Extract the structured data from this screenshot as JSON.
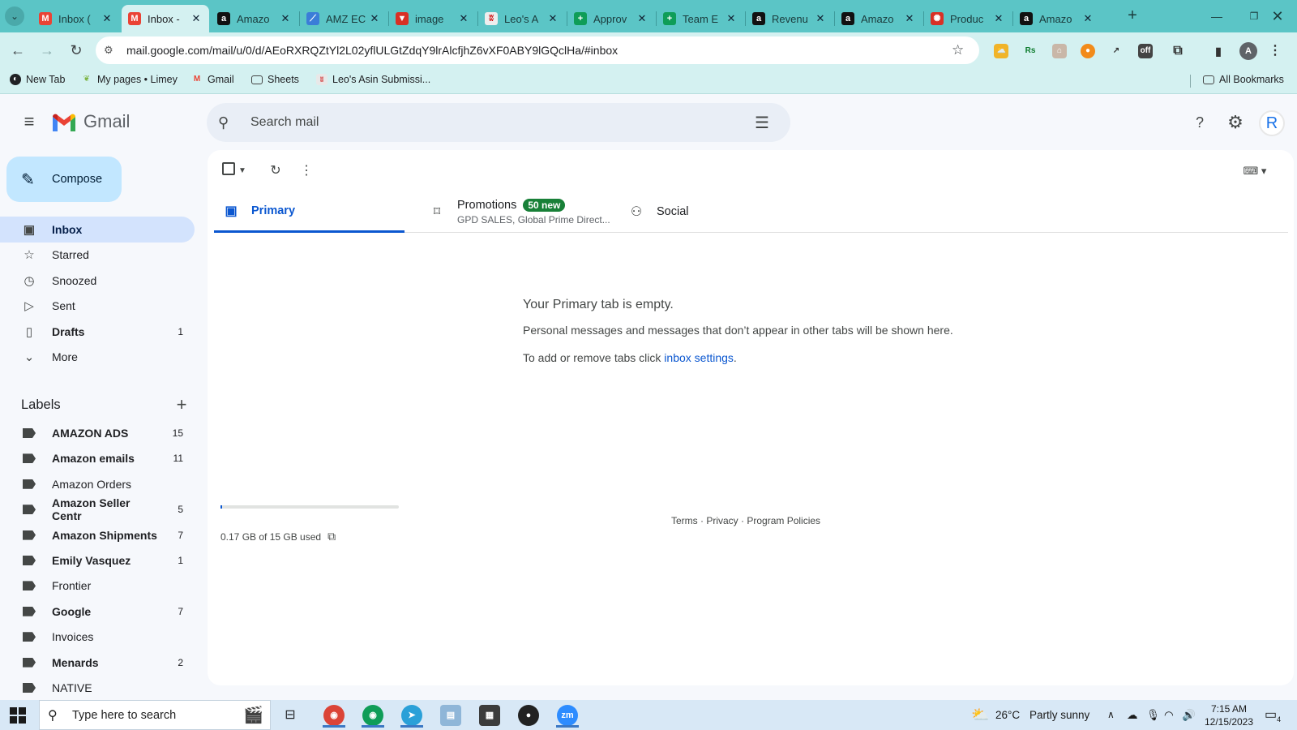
{
  "browser": {
    "tabs": [
      {
        "title": "Inbox (",
        "favicon": "gmail-favicon",
        "active": false
      },
      {
        "title": "Inbox -",
        "favicon": "gmail-favicon",
        "active": true
      },
      {
        "title": "Amazo",
        "favicon": "amazon-favicon",
        "active": false
      },
      {
        "title": "AMZ EC",
        "favicon": "amz-favicon",
        "active": false
      },
      {
        "title": "image",
        "favicon": "image-favicon",
        "active": false
      },
      {
        "title": "Leo's A",
        "favicon": "leo-favicon",
        "active": false
      },
      {
        "title": "Approv",
        "favicon": "sheets-favicon",
        "active": false
      },
      {
        "title": "Team E",
        "favicon": "sheets-favicon",
        "active": false
      },
      {
        "title": "Revenu",
        "favicon": "amazon-favicon",
        "active": false
      },
      {
        "title": "Amazo",
        "favicon": "amazon-favicon",
        "active": false
      },
      {
        "title": "Produc",
        "favicon": "product-favicon",
        "active": false
      },
      {
        "title": "Amazo",
        "favicon": "amazon-favicon",
        "active": false
      }
    ],
    "url": "mail.google.com/mail/u/0/d/AEoRXRQZtYl2L02yflULGtZdqY9lrAlcfjhZ6vXF0ABY9lGQclHa/#inbox",
    "bookmarks": {
      "new_tab": "New Tab",
      "my_pages": "My pages • Limey",
      "gmail": "Gmail",
      "sheets": "Sheets",
      "leos": "Leo's Asin Submissi...",
      "all": "All Bookmarks"
    },
    "theme_color": "#5bc5c6"
  },
  "gmail": {
    "brand": "Gmail",
    "search_placeholder": "Search mail",
    "avatar_letter": "R",
    "compose_label": "Compose",
    "nav": [
      {
        "label": "Inbox",
        "icon": "inbox-icon",
        "count": "",
        "active": true,
        "bold": true
      },
      {
        "label": "Starred",
        "icon": "star-icon",
        "count": "",
        "active": false,
        "bold": false
      },
      {
        "label": "Snoozed",
        "icon": "clock-icon",
        "count": "",
        "active": false,
        "bold": false
      },
      {
        "label": "Sent",
        "icon": "send-icon",
        "count": "",
        "active": false,
        "bold": false
      },
      {
        "label": "Drafts",
        "icon": "draft-icon",
        "count": "1",
        "active": false,
        "bold": true
      },
      {
        "label": "More",
        "icon": "chevron-down-icon",
        "count": "",
        "active": false,
        "bold": false
      }
    ],
    "labels_title": "Labels",
    "labels": [
      {
        "label": "AMAZON ADS",
        "count": "15",
        "bold": true
      },
      {
        "label": "Amazon emails",
        "count": "11",
        "bold": true
      },
      {
        "label": "Amazon Orders",
        "count": "",
        "bold": false
      },
      {
        "label": "Amazon Seller Centr",
        "count": "5",
        "bold": true
      },
      {
        "label": "Amazon Shipments",
        "count": "7",
        "bold": true
      },
      {
        "label": "Emily Vasquez",
        "count": "1",
        "bold": true
      },
      {
        "label": "Frontier",
        "count": "",
        "bold": false
      },
      {
        "label": "Google",
        "count": "7",
        "bold": true
      },
      {
        "label": "Invoices",
        "count": "",
        "bold": false
      },
      {
        "label": "Menards",
        "count": "2",
        "bold": true
      },
      {
        "label": "NATIVE",
        "count": "",
        "bold": false
      }
    ],
    "tabs": {
      "primary": "Primary",
      "promotions": "Promotions",
      "promotions_badge": "50 new",
      "promotions_sub": "GPD SALES, Global Prime Direct...",
      "social": "Social"
    },
    "empty": {
      "title": "Your Primary tab is empty.",
      "line1": "Personal messages and messages that don’t appear in other tabs will be shown here.",
      "line2_prefix": "To add or remove tabs click ",
      "line2_link": "inbox settings",
      "line2_suffix": "."
    },
    "storage": {
      "text": "0.17 GB of 15 GB used",
      "used_fraction": 0.011
    },
    "footer": {
      "terms": "Terms",
      "privacy": "Privacy",
      "policies": "Program Policies",
      "sep": " · "
    }
  },
  "taskbar": {
    "search_placeholder": "Type here to search",
    "weather_temp": "26°C",
    "weather_text": "Partly sunny",
    "time": "7:15 AM",
    "date": "12/15/2023",
    "notif_count": "4"
  }
}
